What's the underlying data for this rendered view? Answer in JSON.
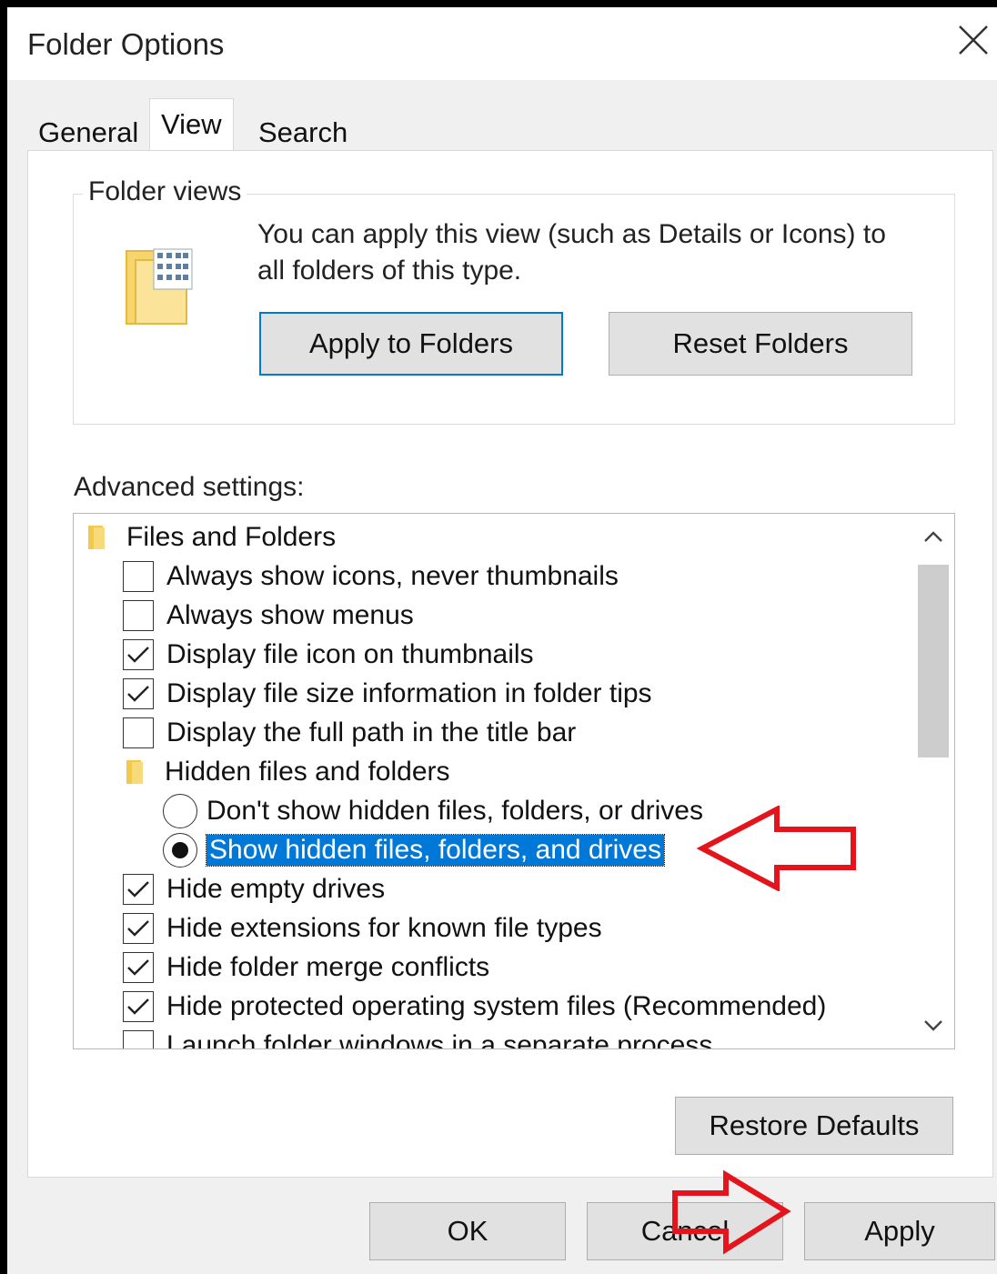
{
  "window": {
    "title": "Folder Options",
    "close_icon": "close-icon"
  },
  "tabs": [
    {
      "label": "General",
      "active": false
    },
    {
      "label": "View",
      "active": true
    },
    {
      "label": "Search",
      "active": false
    }
  ],
  "folder_views": {
    "label": "Folder views",
    "description_line1": "You can apply this view (such as Details or Icons) to",
    "description_line2": "all folders of this type.",
    "apply_button": "Apply to Folders",
    "reset_button": "Reset Folders"
  },
  "advanced": {
    "label": "Advanced settings:",
    "items": [
      {
        "type": "folder",
        "label": "Files and Folders"
      },
      {
        "type": "checkbox",
        "label": "Always show icons, never thumbnails",
        "checked": false
      },
      {
        "type": "checkbox",
        "label": "Always show menus",
        "checked": false
      },
      {
        "type": "checkbox",
        "label": "Display file icon on thumbnails",
        "checked": true
      },
      {
        "type": "checkbox",
        "label": "Display file size information in folder tips",
        "checked": true
      },
      {
        "type": "checkbox",
        "label": "Display the full path in the title bar",
        "checked": false
      },
      {
        "type": "folder",
        "label": "Hidden files and folders"
      },
      {
        "type": "radio",
        "label": "Don't show hidden files, folders, or drives",
        "checked": false
      },
      {
        "type": "radio",
        "label": "Show hidden files, folders, and drives",
        "checked": true,
        "highlighted": true
      },
      {
        "type": "checkbox",
        "label": "Hide empty drives",
        "checked": true
      },
      {
        "type": "checkbox",
        "label": "Hide extensions for known file types",
        "checked": true
      },
      {
        "type": "checkbox",
        "label": "Hide folder merge conflicts",
        "checked": true
      },
      {
        "type": "checkbox",
        "label": "Hide protected operating system files (Recommended)",
        "checked": true
      },
      {
        "type": "checkbox",
        "label": "Launch folder windows in a separate process",
        "checked": false
      }
    ],
    "restore_button": "Restore Defaults"
  },
  "footer": {
    "ok": "OK",
    "cancel": "Cancel",
    "apply": "Apply"
  },
  "colors": {
    "selection": "#0078d7",
    "annotation_arrow": "#e3141b"
  }
}
